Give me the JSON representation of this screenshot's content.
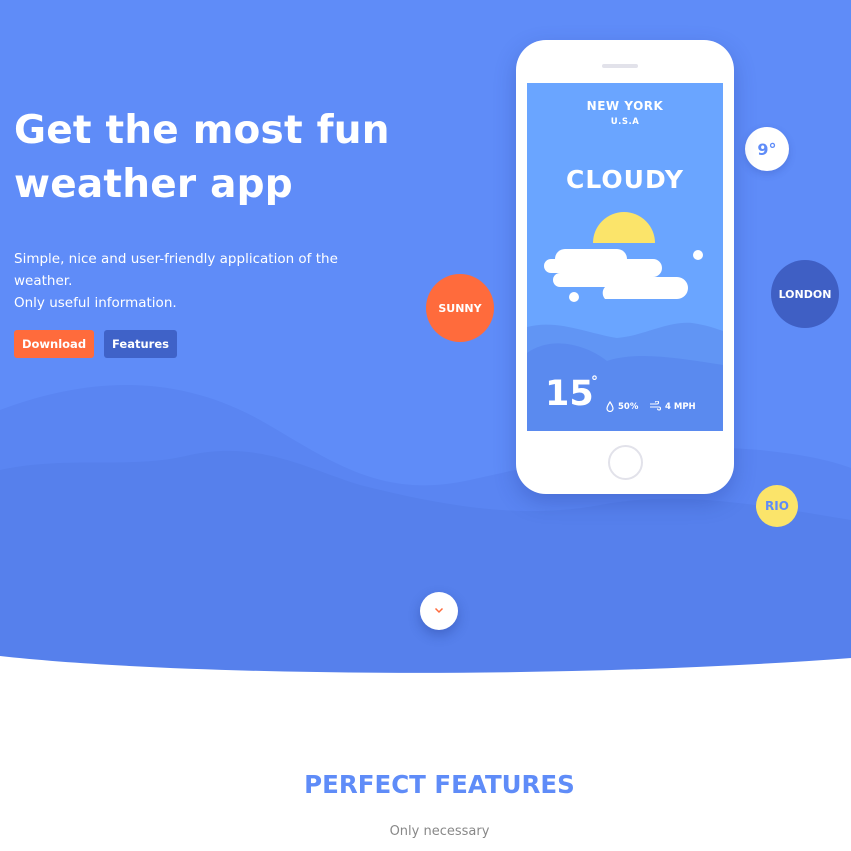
{
  "hero": {
    "headline_line1": "Get the most fun",
    "headline_line2": "weather app",
    "subtext_line1": "Simple, nice and user-friendly application of the weather.",
    "subtext_line2": "Only useful information.",
    "download_label": "Download",
    "features_label": "Features"
  },
  "phone": {
    "city": "NEW YORK",
    "country": "U.S.A",
    "condition": "CLOUDY",
    "temperature": "15",
    "degree_symbol": "°",
    "humidity": "50%",
    "wind": "4 MPH"
  },
  "bubbles": {
    "sunny": "SUNNY",
    "temp": "9°",
    "london": "LONDON",
    "rio": "RIO"
  },
  "features_section": {
    "title": "PERFECT FEATURES",
    "subtitle": "Only necessary"
  },
  "icons": {
    "scroll": "chevron-down-icon",
    "humidity": "droplet-icon",
    "wind": "wind-icon",
    "weather": "sun-cloud-icon"
  },
  "colors": {
    "hero_background": "#5f8cf8",
    "accent_orange": "#ff6b3c",
    "accent_dark_blue": "#3f62c8",
    "accent_yellow": "#fbe46a",
    "screen_blue": "#6aa5ff"
  }
}
